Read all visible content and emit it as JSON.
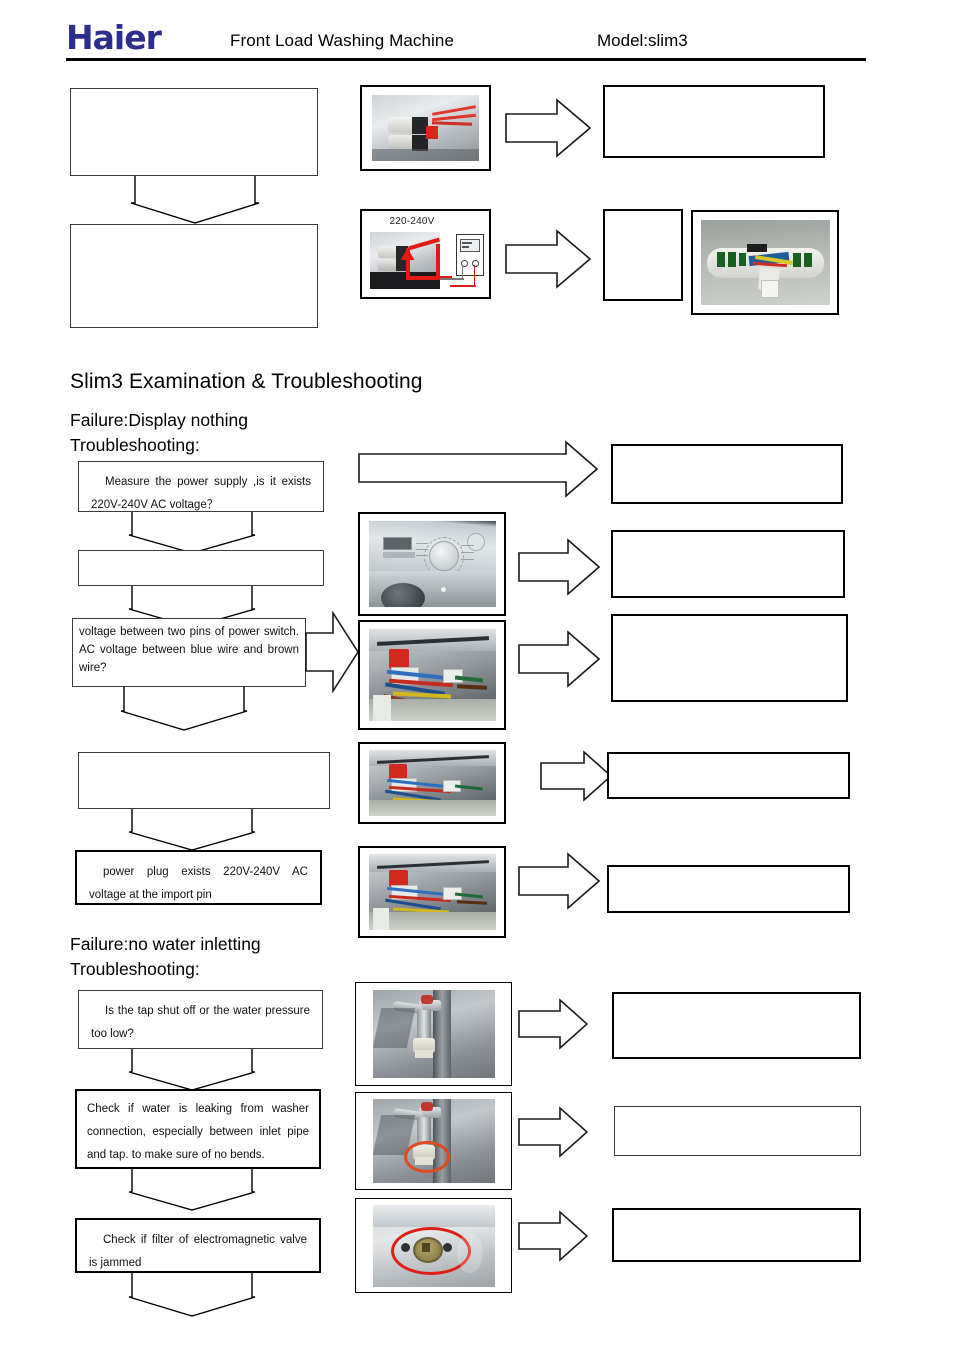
{
  "header": {
    "logo_text": "Haier",
    "title": "Front Load Washing Machine",
    "model": "Model:slim3",
    "logo_color": "#2d2d8c"
  },
  "top_flow": {
    "box1_text": "",
    "box2_text": "",
    "photo1_label": "",
    "photo2_label": "220-240V",
    "result1_text": "",
    "result2_text": "",
    "pcb_photo_label": "",
    "icons": {
      "down_arrow": "down-arrow-icon",
      "right_arrow": "right-arrow-icon"
    }
  },
  "section": {
    "heading": "Slim3 Examination & Troubleshooting",
    "failure1": {
      "failure_label": "Failure:Display nothing",
      "troubleshooting_label": "Troubleshooting:",
      "steps": [
        {
          "text": "Measure  the  power  supply  ,is  it  exists 220V-240V AC voltage？",
          "photo": "",
          "result": ""
        },
        {
          "text": "",
          "photo": "washer-control-panel-photo",
          "result": ""
        },
        {
          "text": "voltage between  two  pins  of  power  switch.  AC voltage between blue wire and brown wire?",
          "photo": "wiring-harness-photo",
          "result": ""
        },
        {
          "text": "",
          "photo": "wiring-harness-photo",
          "result": ""
        },
        {
          "text": "power plug exists 220V-240V AC voltage at the import pin",
          "photo": "wiring-harness-photo",
          "result": ""
        }
      ]
    },
    "failure2": {
      "failure_label": "Failure:no water inletting",
      "troubleshooting_label": "Troubleshooting:",
      "steps": [
        {
          "text": "Is  the  tap  shut  off  or  the  water  pressure too low?",
          "photo": "water-tap-photo",
          "result": ""
        },
        {
          "text": "Check  if  water  is  leaking  from  washer connection,  especially  between  inlet  pipe and tap. to make sure of no bends.",
          "photo": "water-tap-connection-photo",
          "result": ""
        },
        {
          "text": "Check if filter of electromagnetic valve is jammed",
          "photo": "valve-filter-photo",
          "result": ""
        }
      ]
    }
  }
}
